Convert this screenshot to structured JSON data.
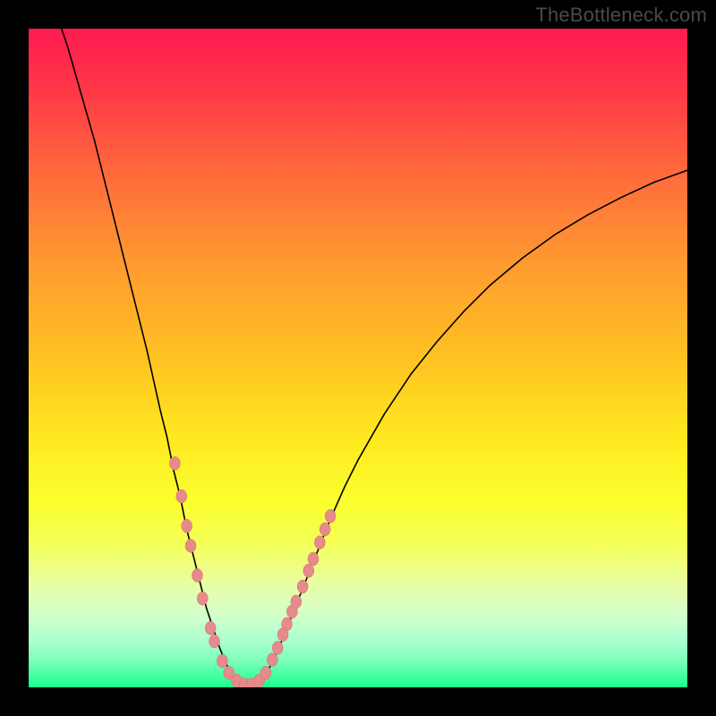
{
  "watermark": "TheBottleneck.com",
  "chart_data": {
    "type": "line",
    "title": "",
    "xlabel": "",
    "ylabel": "",
    "xlim": [
      0,
      100
    ],
    "ylim": [
      0,
      100
    ],
    "grid": false,
    "legend": false,
    "series": [
      {
        "name": "bottleneck-curve",
        "points": [
          [
            4,
            103
          ],
          [
            6,
            97
          ],
          [
            8,
            90
          ],
          [
            10,
            83
          ],
          [
            12,
            75
          ],
          [
            14,
            67
          ],
          [
            16,
            59
          ],
          [
            18,
            51
          ],
          [
            20,
            42
          ],
          [
            21,
            38
          ],
          [
            22,
            33
          ],
          [
            23,
            29
          ],
          [
            24,
            24
          ],
          [
            25,
            20
          ],
          [
            26,
            16
          ],
          [
            27,
            12
          ],
          [
            28,
            9
          ],
          [
            29,
            6
          ],
          [
            30,
            3.5
          ],
          [
            31,
            1.8
          ],
          [
            32,
            0.8
          ],
          [
            33,
            0.2
          ],
          [
            34,
            0.2
          ],
          [
            35,
            0.8
          ],
          [
            36,
            2
          ],
          [
            37,
            3.8
          ],
          [
            38,
            6
          ],
          [
            39,
            8.5
          ],
          [
            40,
            11
          ],
          [
            42,
            16
          ],
          [
            44,
            21
          ],
          [
            46,
            26
          ],
          [
            48,
            30.5
          ],
          [
            50,
            34.5
          ],
          [
            54,
            41.5
          ],
          [
            58,
            47.5
          ],
          [
            62,
            52.5
          ],
          [
            66,
            57
          ],
          [
            70,
            61
          ],
          [
            75,
            65.2
          ],
          [
            80,
            68.8
          ],
          [
            85,
            71.8
          ],
          [
            90,
            74.4
          ],
          [
            95,
            76.7
          ],
          [
            100,
            78.5
          ]
        ]
      }
    ],
    "markers": {
      "name": "data-points",
      "radius_px": 6,
      "color": "#e68a8a",
      "points": [
        [
          22.2,
          34
        ],
        [
          23.2,
          29
        ],
        [
          24.0,
          24.5
        ],
        [
          24.6,
          21.5
        ],
        [
          25.6,
          17
        ],
        [
          26.4,
          13.5
        ],
        [
          27.6,
          9
        ],
        [
          28.2,
          7
        ],
        [
          29.4,
          4
        ],
        [
          30.4,
          2.2
        ],
        [
          31.6,
          1
        ],
        [
          32.8,
          0.4
        ],
        [
          33.8,
          0.4
        ],
        [
          35.0,
          1
        ],
        [
          36.0,
          2.2
        ],
        [
          37.0,
          4.2
        ],
        [
          37.8,
          6
        ],
        [
          38.6,
          8
        ],
        [
          39.2,
          9.6
        ],
        [
          40.0,
          11.5
        ],
        [
          40.6,
          13
        ],
        [
          41.6,
          15.3
        ],
        [
          42.5,
          17.7
        ],
        [
          43.2,
          19.5
        ],
        [
          44.2,
          22
        ],
        [
          45.0,
          24
        ],
        [
          45.8,
          26
        ]
      ]
    },
    "background": {
      "type": "vertical-gradient",
      "stops": [
        {
          "pos": 0,
          "color": "#ff1a50"
        },
        {
          "pos": 50,
          "color": "#ffc222"
        },
        {
          "pos": 78,
          "color": "#f4ff56"
        },
        {
          "pos": 100,
          "color": "#18ff8f"
        }
      ]
    }
  }
}
